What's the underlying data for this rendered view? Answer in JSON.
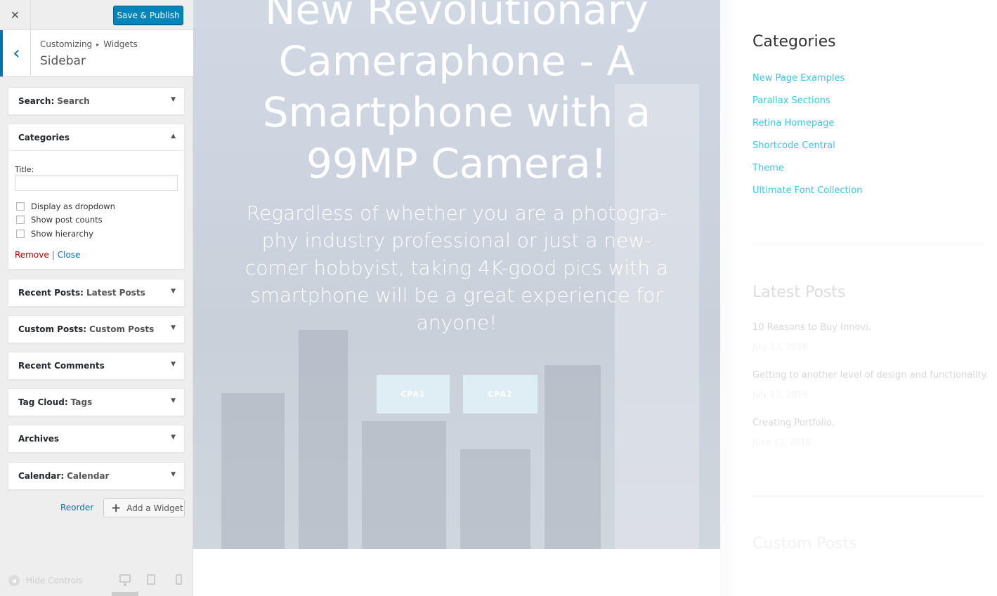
{
  "header": {
    "close_label": "✕",
    "publish_label": "Save & Publish"
  },
  "section": {
    "back_label": "‹",
    "breadcrumb_root": "Customizing",
    "breadcrumb_sep": "▸",
    "breadcrumb_leaf": "Widgets",
    "title": "Sidebar"
  },
  "widgets": [
    {
      "name": "Search",
      "instance": "Search"
    },
    {
      "name": "Categories",
      "instance": ""
    },
    {
      "name": "Recent Posts",
      "instance": "Latest Posts"
    },
    {
      "name": "Custom Posts",
      "instance": "Custom Posts"
    },
    {
      "name": "Recent Comments",
      "instance": ""
    },
    {
      "name": "Tag Cloud",
      "instance": "Tags"
    },
    {
      "name": "Archives",
      "instance": ""
    },
    {
      "name": "Calendar",
      "instance": "Calendar"
    }
  ],
  "categories_form": {
    "title_label": "Title:",
    "title_value": "",
    "options": [
      {
        "label": "Display as dropdown",
        "checked": false
      },
      {
        "label": "Show post counts",
        "checked": false
      },
      {
        "label": "Show hierarchy",
        "checked": false
      }
    ],
    "remove_label": "Remove",
    "pipe": "|",
    "close_label": "Close"
  },
  "panel_footer": {
    "reorder_label": "Reorder",
    "add_widget_label": "Add a Widget",
    "hide_controls_label": "Hide Controls"
  },
  "preview": {
    "hero_title": "New Revolutionary Cameraphone - A Smartphone with a 99MP Camera!",
    "hero_text": "Regardless of whether you are a photogra-phy industry professional or just a new-comer hobbyist, taking 4K-good pics with a smartphone will be a great experience for anyone!",
    "cta1": "CPA1",
    "cta2": "CPA2",
    "sidebar": {
      "categories_heading": "Categories",
      "categories": [
        "New Page Examples",
        "Parallax Sections",
        "Retina Homepage",
        "Shortcode Central",
        "Theme",
        "Ultimate Font Collection"
      ],
      "latest_heading": "Latest Posts",
      "posts": [
        {
          "title": "10 Reasons to Buy Innovi.",
          "date": "July 12, 2016"
        },
        {
          "title": "Getting to another level of design and functionality.",
          "date": "July 12, 2016"
        },
        {
          "title": "Creating Portfolio.",
          "date": "June 12, 2016"
        }
      ],
      "custom_heading": "Custom Posts"
    }
  },
  "colors": {
    "accent": "#0085ba",
    "link": "#0073aa",
    "remove": "#aa0000",
    "category_link": "#3ec3e6"
  }
}
